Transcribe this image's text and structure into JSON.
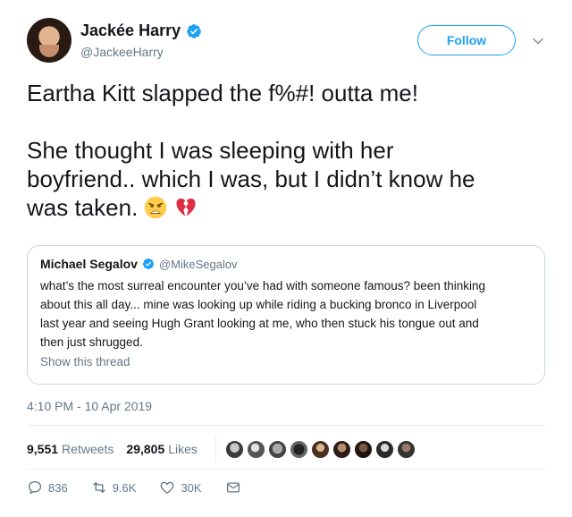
{
  "author": {
    "name": "Jackée Harry",
    "handle": "@JackeeHarry",
    "verified": true
  },
  "follow_label": "Follow",
  "tweet": {
    "line1": "Eartha Kitt slapped the f%#! outta me!",
    "line2": "She thought I was sleeping with her",
    "line3": "boyfriend.. which I was, but I didn’t know he",
    "line4": "was taken.",
    "emojis": [
      "weary-face-icon",
      "broken-heart-icon"
    ]
  },
  "quoted": {
    "name": "Michael Segalov",
    "handle": "@MikeSegalov",
    "verified": true,
    "lines": [
      "what’s the most surreal encounter you’ve had with someone famous? been thinking",
      "about this all day... mine was looking up while riding a bucking bronco in Liverpool",
      "last year and seeing Hugh Grant looking at me, who then stuck his tongue out and",
      "then just shrugged."
    ],
    "show_thread": "Show this thread"
  },
  "timestamp": "4:10 PM - 10 Apr 2019",
  "stats": {
    "retweets_count": "9,551",
    "retweets_label": "Retweets",
    "likes_count": "29,805",
    "likes_label": "Likes"
  },
  "actions": {
    "reply_count": "836",
    "retweet_count": "9.6K",
    "like_count": "30K"
  },
  "colors": {
    "accent": "#1da1f2",
    "muted": "#657786",
    "text": "#14171a",
    "border": "#ccd6dd"
  }
}
